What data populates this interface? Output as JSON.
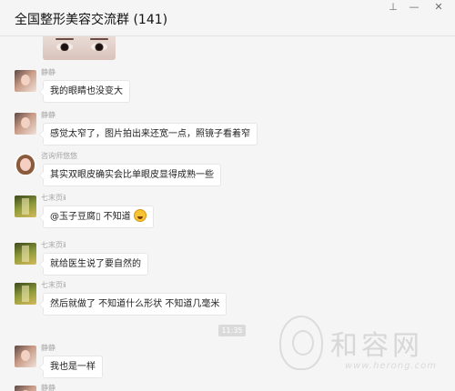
{
  "header": {
    "title": "全国整形美容交流群 (141)",
    "pin_icon": "pin-icon",
    "minimize_label": "—",
    "close_label": "✕"
  },
  "messages": [
    {
      "sender": "静静",
      "avatar": "avatar-jingjing",
      "text": "我的眼睛也没变大"
    },
    {
      "sender": "静静",
      "avatar": "avatar-jingjing",
      "text": "感觉太窄了，图片拍出来还宽一点，照镜子看着窄"
    },
    {
      "sender": "咨询师悠悠",
      "avatar": "avatar-consultant",
      "text": "其实双眼皮确实会比单眼皮显得成熟一些"
    },
    {
      "sender": "七末页ⅱ",
      "avatar": "avatar-qimo",
      "text": "@玉子豆腐▯ 不知道",
      "emoji": "laughing-emoji"
    },
    {
      "sender": "七末页ⅱ",
      "avatar": "avatar-qimo",
      "text": "就给医生说了要自然的"
    },
    {
      "sender": "七末页ⅱ",
      "avatar": "avatar-qimo",
      "text": "然后就做了 不知道什么形状 不知道几毫米"
    },
    {
      "sender": "静静",
      "avatar": "avatar-jingjing",
      "text": "我也是一样"
    },
    {
      "sender": "静静",
      "avatar": "avatar-jingjing",
      "text": ""
    }
  ],
  "time_separator": "11:35",
  "watermark": {
    "title": "和容网",
    "url": "www.herong.com"
  },
  "colors": {
    "background": "#f5f5f5",
    "bubble": "#ffffff",
    "sender_name": "#a6a6a6"
  }
}
